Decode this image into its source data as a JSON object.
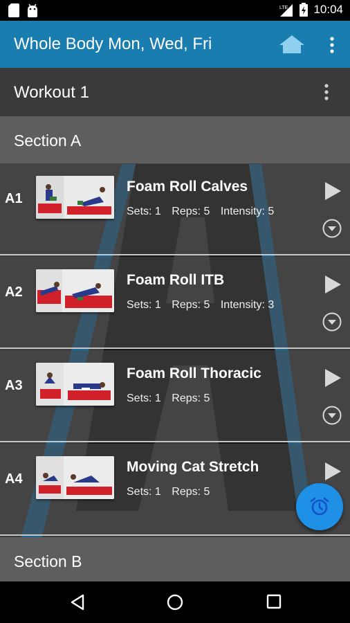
{
  "status_bar": {
    "time": "10:04",
    "network": "LTE"
  },
  "app_bar": {
    "title": "Whole Body Mon, Wed, Fri"
  },
  "workout": {
    "label": "Workout 1"
  },
  "sections": [
    {
      "label": "Section A"
    },
    {
      "label": "Section B"
    }
  ],
  "exercises": [
    {
      "code": "A1",
      "name": "Foam Roll Calves",
      "sets": "Sets: 1",
      "reps": "Reps: 5",
      "intensity": "Intensity: 5"
    },
    {
      "code": "A2",
      "name": "Foam Roll ITB",
      "sets": "Sets: 1",
      "reps": "Reps: 5",
      "intensity": "Intensity: 3"
    },
    {
      "code": "A3",
      "name": "Foam Roll Thoracic",
      "sets": "Sets: 1",
      "reps": "Reps: 5",
      "intensity": ""
    },
    {
      "code": "A4",
      "name": "Moving Cat Stretch",
      "sets": "Sets: 1",
      "reps": "Reps: 5",
      "intensity": ""
    }
  ],
  "colors": {
    "app_bar": "#1a7db0",
    "fab": "#1e90e6",
    "fab_icon": "#1452c8",
    "section_header": "#5e5e5e",
    "row_bg": "#4c4c4c",
    "mat_red": "#d0202a"
  },
  "icons": {
    "home": "home-icon",
    "more": "more-vert-icon",
    "play": "play-icon",
    "expand": "expand-circle-icon",
    "alarm": "alarm-icon"
  }
}
